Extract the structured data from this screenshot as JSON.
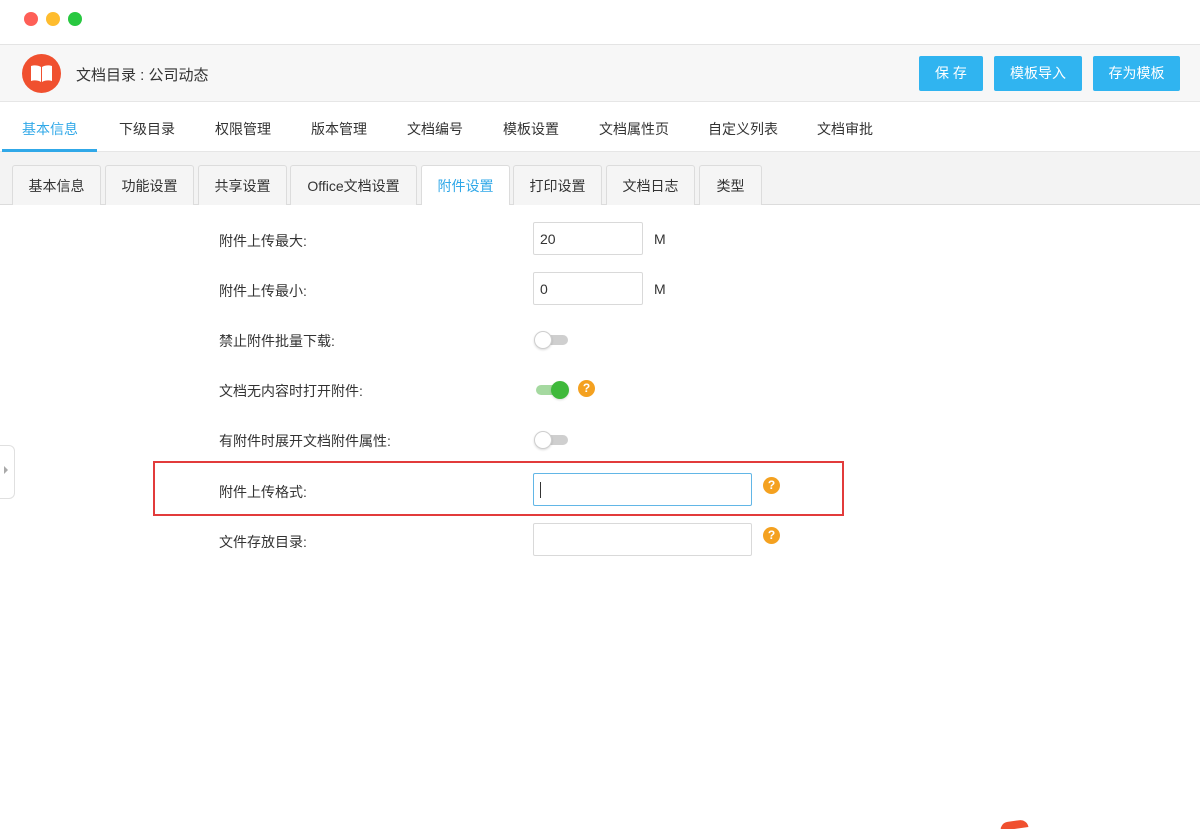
{
  "window": {
    "traffic_lights": [
      "close",
      "minimize",
      "maximize"
    ]
  },
  "header": {
    "logo_icon": "book-icon",
    "title": "文档目录 : 公司动态",
    "buttons": {
      "save": "保 存",
      "template_import": "模板导入",
      "save_as_template": "存为模板"
    }
  },
  "main_tabs": [
    "基本信息",
    "下级目录",
    "权限管理",
    "版本管理",
    "文档编号",
    "模板设置",
    "文档属性页",
    "自定义列表",
    "文档审批"
  ],
  "main_tab_active": "基本信息",
  "sub_tabs": [
    "基本信息",
    "功能设置",
    "共享设置",
    "Office文档设置",
    "附件设置",
    "打印设置",
    "文档日志",
    "类型"
  ],
  "sub_tab_active": "附件设置",
  "form": {
    "max_upload": {
      "label": "附件上传最大:",
      "value": "20",
      "unit": "M"
    },
    "min_upload": {
      "label": "附件上传最小:",
      "value": "0",
      "unit": "M"
    },
    "disable_batch_download": {
      "label": "禁止附件批量下载:",
      "on": false
    },
    "open_attachment_if_empty": {
      "label": "文档无内容时打开附件:",
      "on": true,
      "help": "?"
    },
    "expand_attachment_props": {
      "label": "有附件时展开文档附件属性:",
      "on": false
    },
    "upload_format": {
      "label": "附件上传格式:",
      "value": "",
      "help": "?"
    },
    "storage_dir": {
      "label": "文件存放目录:",
      "value": "",
      "help": "?"
    }
  },
  "colors": {
    "accent": "#30a8e8",
    "button": "#30b4f0",
    "logo": "#f0502f",
    "toggle_on": "#3fb93b",
    "help": "#f4a120",
    "highlight": "#e23b3b"
  }
}
